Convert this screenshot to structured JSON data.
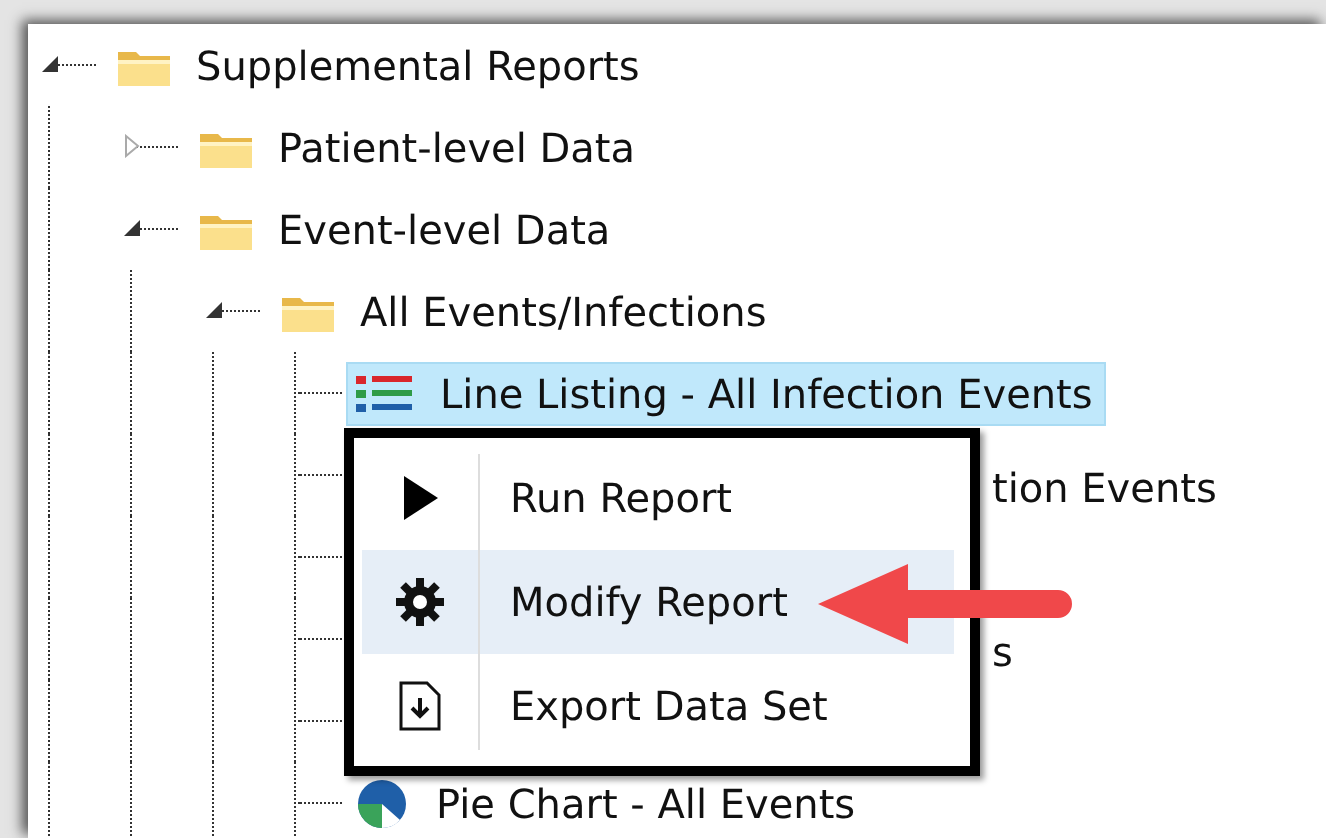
{
  "tree": [
    {
      "label": "Supplemental Reports",
      "kind": "folder",
      "expanded": true,
      "children": [
        {
          "label": "Patient-level Data",
          "kind": "folder",
          "expanded": false
        },
        {
          "label": "Event-level Data",
          "kind": "folder",
          "expanded": true,
          "children": [
            {
              "label": "All Events/Infections",
              "kind": "folder",
              "expanded": true,
              "children": [
                {
                  "label": "Line Listing - All Infection Events",
                  "kind": "line-listing",
                  "selected": true
                },
                {
                  "label": "tion Events",
                  "kind": "covered",
                  "selected": false
                },
                {
                  "label": "s",
                  "kind": "covered",
                  "selected": false
                },
                {
                  "label": "Pie Chart - All Events",
                  "kind": "pie-chart",
                  "selected": false
                }
              ]
            }
          ]
        }
      ]
    }
  ],
  "context_menu": {
    "items": [
      {
        "label": "Run Report",
        "selected": false
      },
      {
        "label": "Modify Report",
        "selected": true
      },
      {
        "label": "Export Data Set",
        "selected": false
      }
    ]
  }
}
